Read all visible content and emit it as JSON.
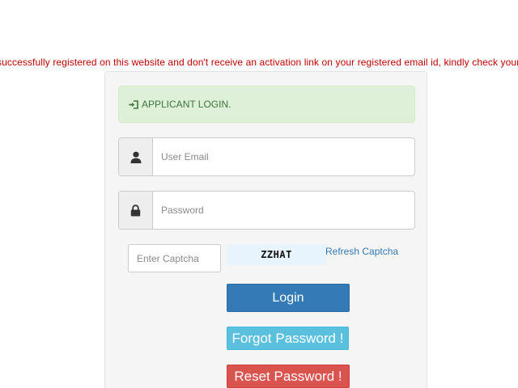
{
  "notice": "successfully registered on this website and don't receive an activation link on your registered email id, kindly check your spam",
  "alert": {
    "icon": "sign-in-icon",
    "text": "APPLICANT LOGIN."
  },
  "email": {
    "icon": "user-icon",
    "placeholder": "User Email",
    "value": ""
  },
  "password": {
    "icon": "lock-icon",
    "placeholder": "Password",
    "value": ""
  },
  "captcha": {
    "placeholder": "Enter Captcha",
    "value": "",
    "code": "ZZHAT",
    "refresh_label": "Refresh Captcha"
  },
  "buttons": {
    "login": "Login",
    "forgot": "Forgot Password !",
    "reset": "Reset Password !"
  },
  "colors": {
    "notice": "#c00000",
    "alert_bg": "#dff0d8",
    "alert_text": "#3c763d",
    "login": "#337ab7",
    "forgot": "#5bc0de",
    "reset": "#d9534f",
    "link": "#337ab7"
  }
}
